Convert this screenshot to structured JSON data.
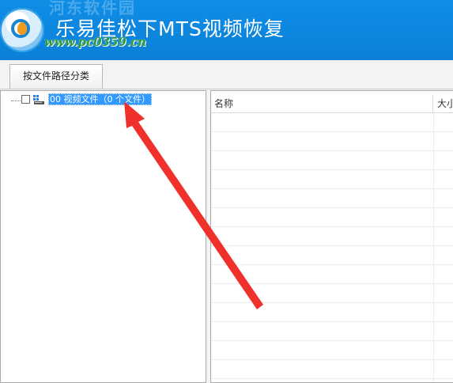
{
  "titlebar": {
    "title": "乐易佳松下MTS视频恢复",
    "watermark_top": "河东软件园",
    "watermark_url": "www.pc0359.cn"
  },
  "tabs": [
    {
      "label": "按文件路径分类",
      "active": true
    }
  ],
  "tree": {
    "root": {
      "label": "00 视频文件（0 个文件）",
      "checked": false,
      "selected": true,
      "icon": "drive-icon"
    }
  },
  "file_list": {
    "columns": [
      {
        "label": "名称"
      },
      {
        "label": "大小"
      }
    ],
    "rows": []
  },
  "colors": {
    "titlebar": "#0b7fd8",
    "selection": "#3399ff",
    "annotation_arrow": "#f0302a"
  }
}
